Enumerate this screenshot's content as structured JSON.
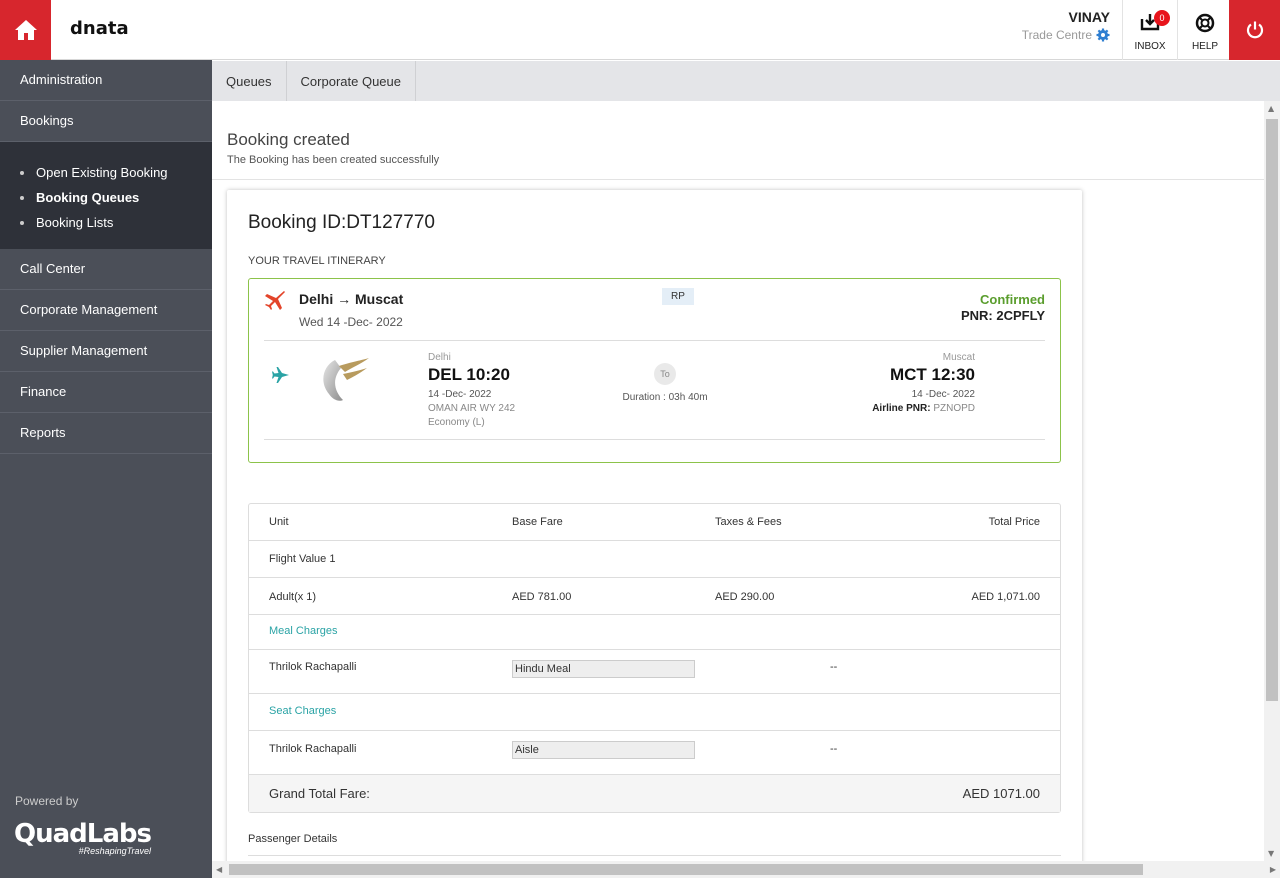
{
  "app": {
    "brand": "dnata"
  },
  "user": {
    "name": "VINAY",
    "centre": "Trade Centre"
  },
  "toolbar": {
    "inbox_label": "INBOX",
    "inbox_count": "0",
    "help_label": "HELP"
  },
  "sidebar": {
    "items": [
      {
        "label": "Administration"
      },
      {
        "label": "Bookings"
      },
      {
        "label": "Call Center"
      },
      {
        "label": "Corporate Management"
      },
      {
        "label": "Supplier Management"
      },
      {
        "label": "Finance"
      },
      {
        "label": "Reports"
      }
    ],
    "sub_items": [
      {
        "label": "Open Existing Booking"
      },
      {
        "label": "Booking Queues"
      },
      {
        "label": "Booking Lists"
      }
    ],
    "powered_by": "Powered by",
    "logo_text": "QuadLabs",
    "logo_tag": "#ReshapingTravel"
  },
  "tabs": [
    {
      "label": "Queues"
    },
    {
      "label": "Corporate Queue"
    }
  ],
  "page": {
    "title": "Booking created",
    "subtitle": "The Booking has been created successfully"
  },
  "booking": {
    "id_label": "Booking ID:DT127770",
    "itinerary_label": "YOUR TRAVEL ITINERARY",
    "route": "Delhi → Muscat",
    "date": "Wed 14 -Dec- 2022",
    "fare_type": "RP",
    "status": "Confirmed",
    "pnr": "PNR: 2CPFLY",
    "segment": {
      "dep_city": "Delhi",
      "dep_time": "DEL 10:20",
      "dep_date": "14 -Dec- 2022",
      "flight": "OMAN AIR WY 242",
      "cabin": "Economy (L)",
      "to_label": "To",
      "duration": "Duration : 03h 40m",
      "arr_city": "Muscat",
      "arr_time": "MCT 12:30",
      "arr_date": "14 -Dec- 2022",
      "airline_pnr_label": "Airline PNR:",
      "airline_pnr": "PZNOPD"
    }
  },
  "fare": {
    "headers": {
      "unit": "Unit",
      "base": "Base Fare",
      "taxes": "Taxes & Fees",
      "total": "Total Price"
    },
    "flight_value": "Flight Value 1",
    "adult": {
      "unit": "Adult(x 1)",
      "base": "AED 781.00",
      "taxes": "AED 290.00",
      "total": "AED 1,071.00"
    },
    "meal_label": "Meal Charges",
    "meal": {
      "passenger": "Thrilok Rachapalli",
      "value": "Hindu Meal",
      "price": "--"
    },
    "seat_label": "Seat Charges",
    "seat": {
      "passenger": "Thrilok Rachapalli",
      "value": "Aisle",
      "price": "--"
    },
    "grand_total_label": "Grand Total Fare:",
    "grand_total": "AED 1071.00"
  },
  "passenger_details_label": "Passenger Details",
  "colors": {
    "brand_red": "#d7262d",
    "sidebar": "#4b4f58",
    "confirmed": "#5a9d2d",
    "teal": "#2aa3a5"
  }
}
